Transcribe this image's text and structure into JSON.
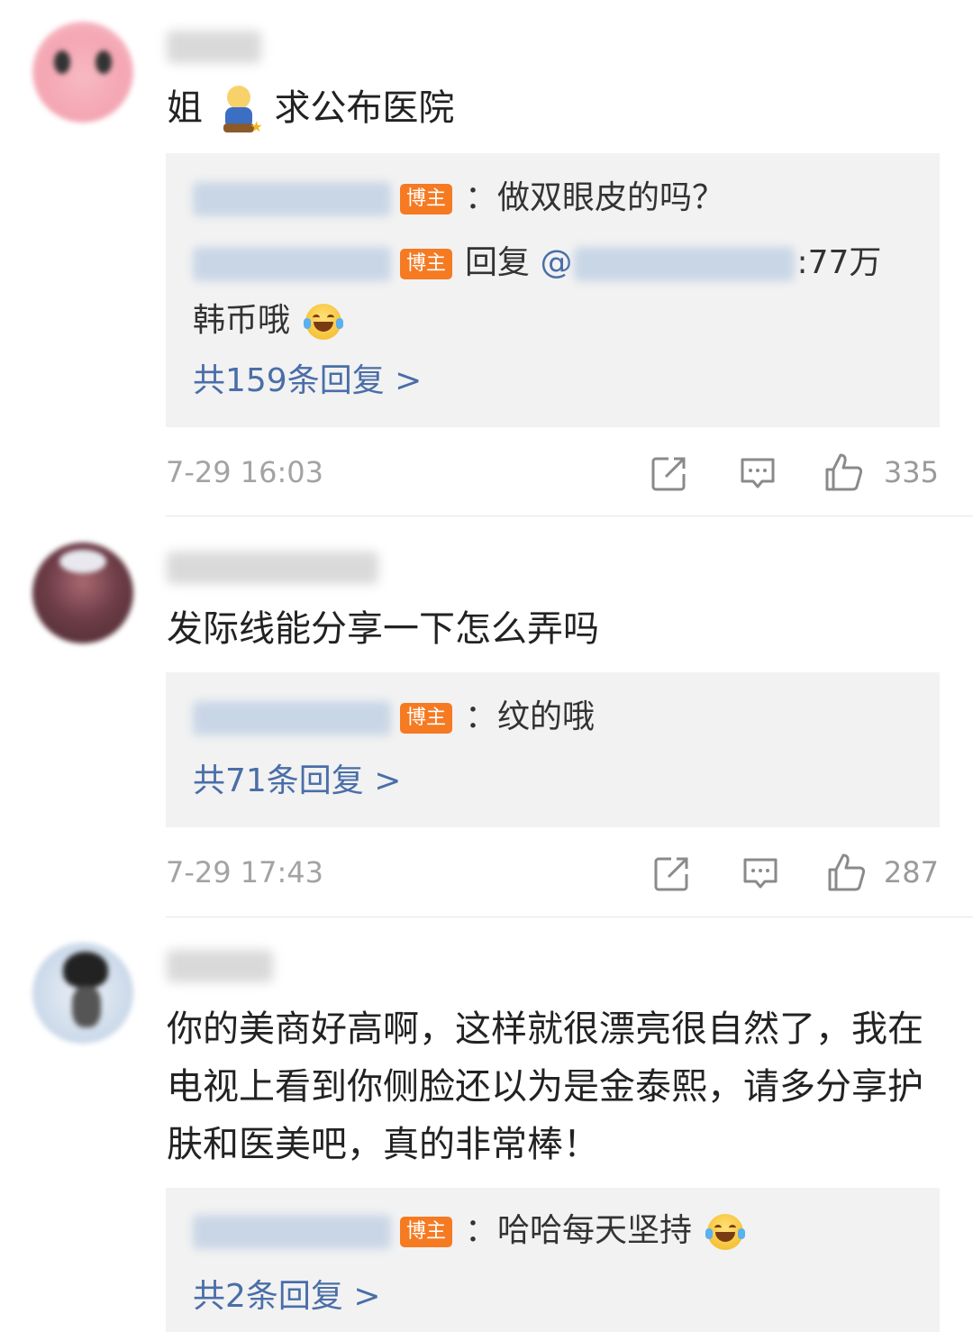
{
  "comments": [
    {
      "text": "姐 求公布医院",
      "text_before_emoji": "姐",
      "text_after_emoji": "求公布医院",
      "replies": [
        {
          "badge": "博主",
          "text": "：做双眼皮的吗？"
        },
        {
          "badge": "博主",
          "prefix": "回复",
          "at": "@",
          "text": ":77万韩币哦"
        }
      ],
      "more_replies": "共159条回复 >",
      "timestamp": "7-29 16:03",
      "likes": "335"
    },
    {
      "text": "发际线能分享一下怎么弄吗",
      "replies": [
        {
          "badge": "博主",
          "text": "：纹的哦"
        }
      ],
      "more_replies": "共71条回复 >",
      "timestamp": "7-29 17:43",
      "likes": "287"
    },
    {
      "text": "你的美商好高啊，这样就很漂亮很自然了，我在电视上看到你侧脸还以为是金泰熙，请多分享护肤和医美吧，真的非常棒！",
      "replies": [
        {
          "badge": "博主",
          "text": "：哈哈每天坚持"
        }
      ],
      "more_replies": "共2条回复 >"
    }
  ],
  "icons": {
    "share": "share-icon",
    "comment": "comment-icon",
    "like": "thumbs-up-icon"
  },
  "colors": {
    "link": "#4a6ea8",
    "badge": "#f57a22",
    "reply_bg": "#f2f2f2",
    "meta_text": "#a3a3a3"
  }
}
